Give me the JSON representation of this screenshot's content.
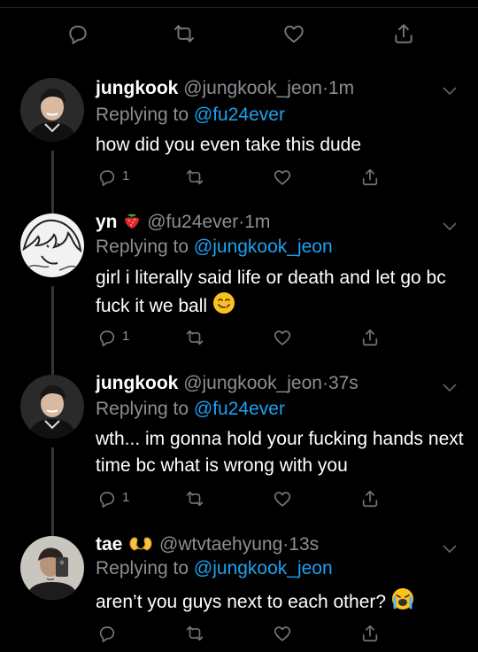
{
  "top_actions": {
    "reply_icon": "reply-icon",
    "retweet_icon": "retweet-icon",
    "like_icon": "heart-icon",
    "share_icon": "share-icon"
  },
  "tweets": [
    {
      "name": "jungkook",
      "name_emoji": "",
      "handle": "@jungkook_jeon",
      "dot": "·",
      "time": "1m",
      "replying_prefix": "Replying to ",
      "replying_handle": "@fu24ever",
      "text": "how did you even take this dude",
      "text_emoji": "",
      "reply_count": "1"
    },
    {
      "name": "yn",
      "name_emoji": "🍓",
      "handle": "@fu24ever",
      "dot": "·",
      "time": "1m",
      "replying_prefix": "Replying to ",
      "replying_handle": "@jungkook_jeon",
      "text": "girl i literally said life or death and let go bc fuck it we ball",
      "text_emoji": "😋",
      "reply_count": "1"
    },
    {
      "name": "jungkook",
      "name_emoji": "",
      "handle": "@jungkook_jeon",
      "dot": "·",
      "time": "37s",
      "replying_prefix": "Replying to ",
      "replying_handle": "@fu24ever",
      "text": "wth... im gonna hold your fucking hands next time bc what is wrong with you",
      "text_emoji": "",
      "reply_count": "1"
    },
    {
      "name": "tae",
      "name_emoji": "🫶",
      "handle": "@wtvtaehyung",
      "dot": "·",
      "time": "13s",
      "replying_prefix": "Replying to ",
      "replying_handle": "@jungkook_jeon",
      "text": "aren’t you guys next to each other?",
      "text_emoji": "😭",
      "reply_count": ""
    }
  ],
  "colors": {
    "background": "#000000",
    "link": "#1da1f2",
    "muted": "#8b8f94",
    "thread_line": "#333639"
  }
}
